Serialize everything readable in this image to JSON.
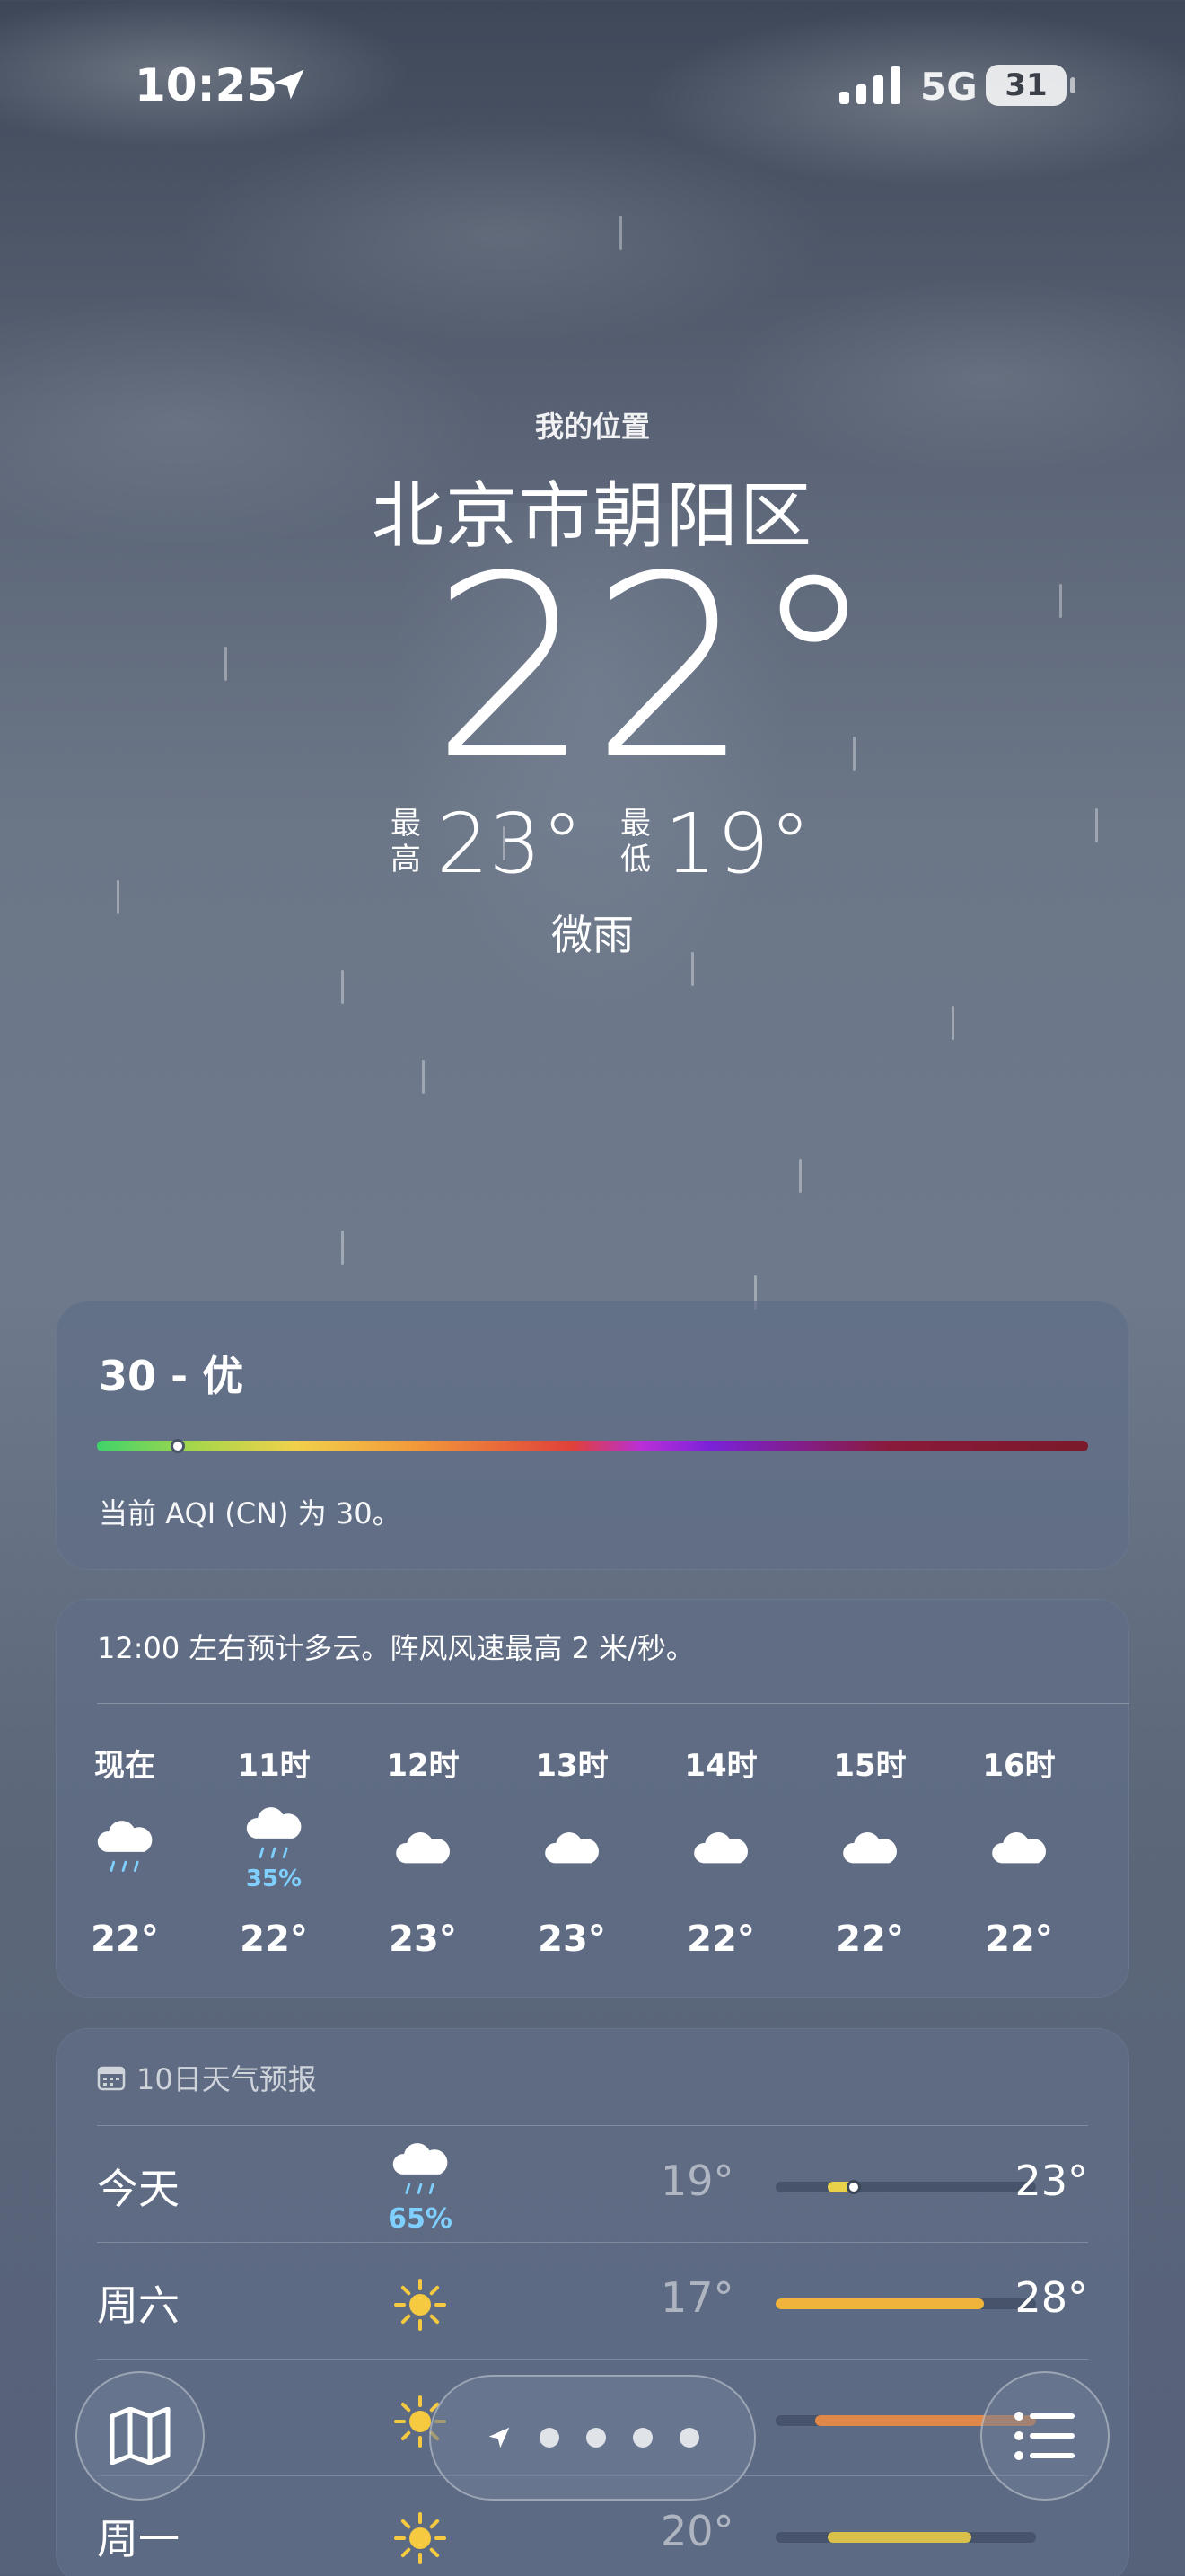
{
  "status_bar": {
    "time": "10:25",
    "location_icon": "location-arrow-icon",
    "signal_icon": "cellular-signal-icon",
    "network": "5G",
    "battery": "31"
  },
  "location": {
    "label": "我的位置",
    "city": "北京市朝阳区"
  },
  "current": {
    "temperature": "22°",
    "high_label": "最高",
    "high": "23°",
    "low_label": "最低",
    "low": "19°",
    "condition": "微雨"
  },
  "aqi": {
    "title": "30 - 优",
    "value": 30,
    "description": "当前 AQI (CN) 为 30。"
  },
  "hourly": {
    "summary": "12:00 左右预计多云。阵风风速最高 2 米/秒。",
    "items": [
      {
        "label": "现在",
        "icon": "rain-cloud-icon",
        "precip": "",
        "temp": "22°"
      },
      {
        "label": "11时",
        "icon": "rain-cloud-icon",
        "precip": "35%",
        "temp": "22°"
      },
      {
        "label": "12时",
        "icon": "cloud-icon",
        "precip": "",
        "temp": "23°"
      },
      {
        "label": "13时",
        "icon": "cloud-icon",
        "precip": "",
        "temp": "23°"
      },
      {
        "label": "14时",
        "icon": "cloud-icon",
        "precip": "",
        "temp": "22°"
      },
      {
        "label": "15时",
        "icon": "cloud-icon",
        "precip": "",
        "temp": "22°"
      },
      {
        "label": "16时",
        "icon": "cloud-icon",
        "precip": "",
        "temp": "22°"
      }
    ]
  },
  "tenday": {
    "title": "10日天气预报",
    "calendar_icon": "calendar-icon",
    "days": [
      {
        "name": "今天",
        "icon": "rain-cloud-icon",
        "precip": "65%",
        "low": "19°",
        "high": "23°",
        "color": "#e8d24a"
      },
      {
        "name": "周六",
        "icon": "sun-icon",
        "precip": "",
        "low": "17°",
        "high": "28°",
        "color": "#f0b43c"
      },
      {
        "name": "",
        "icon": "sun-icon",
        "precip": "",
        "low": "",
        "high": "",
        "color": "#e0884a"
      },
      {
        "name": "周一",
        "icon": "sun-icon",
        "precip": "",
        "low": "20°",
        "high": "",
        "color": "#d9c04a"
      }
    ]
  },
  "bottom_bar": {
    "map_icon": "map-icon",
    "list_icon": "list-icon",
    "page_dots": 4
  },
  "colors": {
    "precip": "#7fd0ff",
    "battery_bg": "#e8e8e8"
  }
}
